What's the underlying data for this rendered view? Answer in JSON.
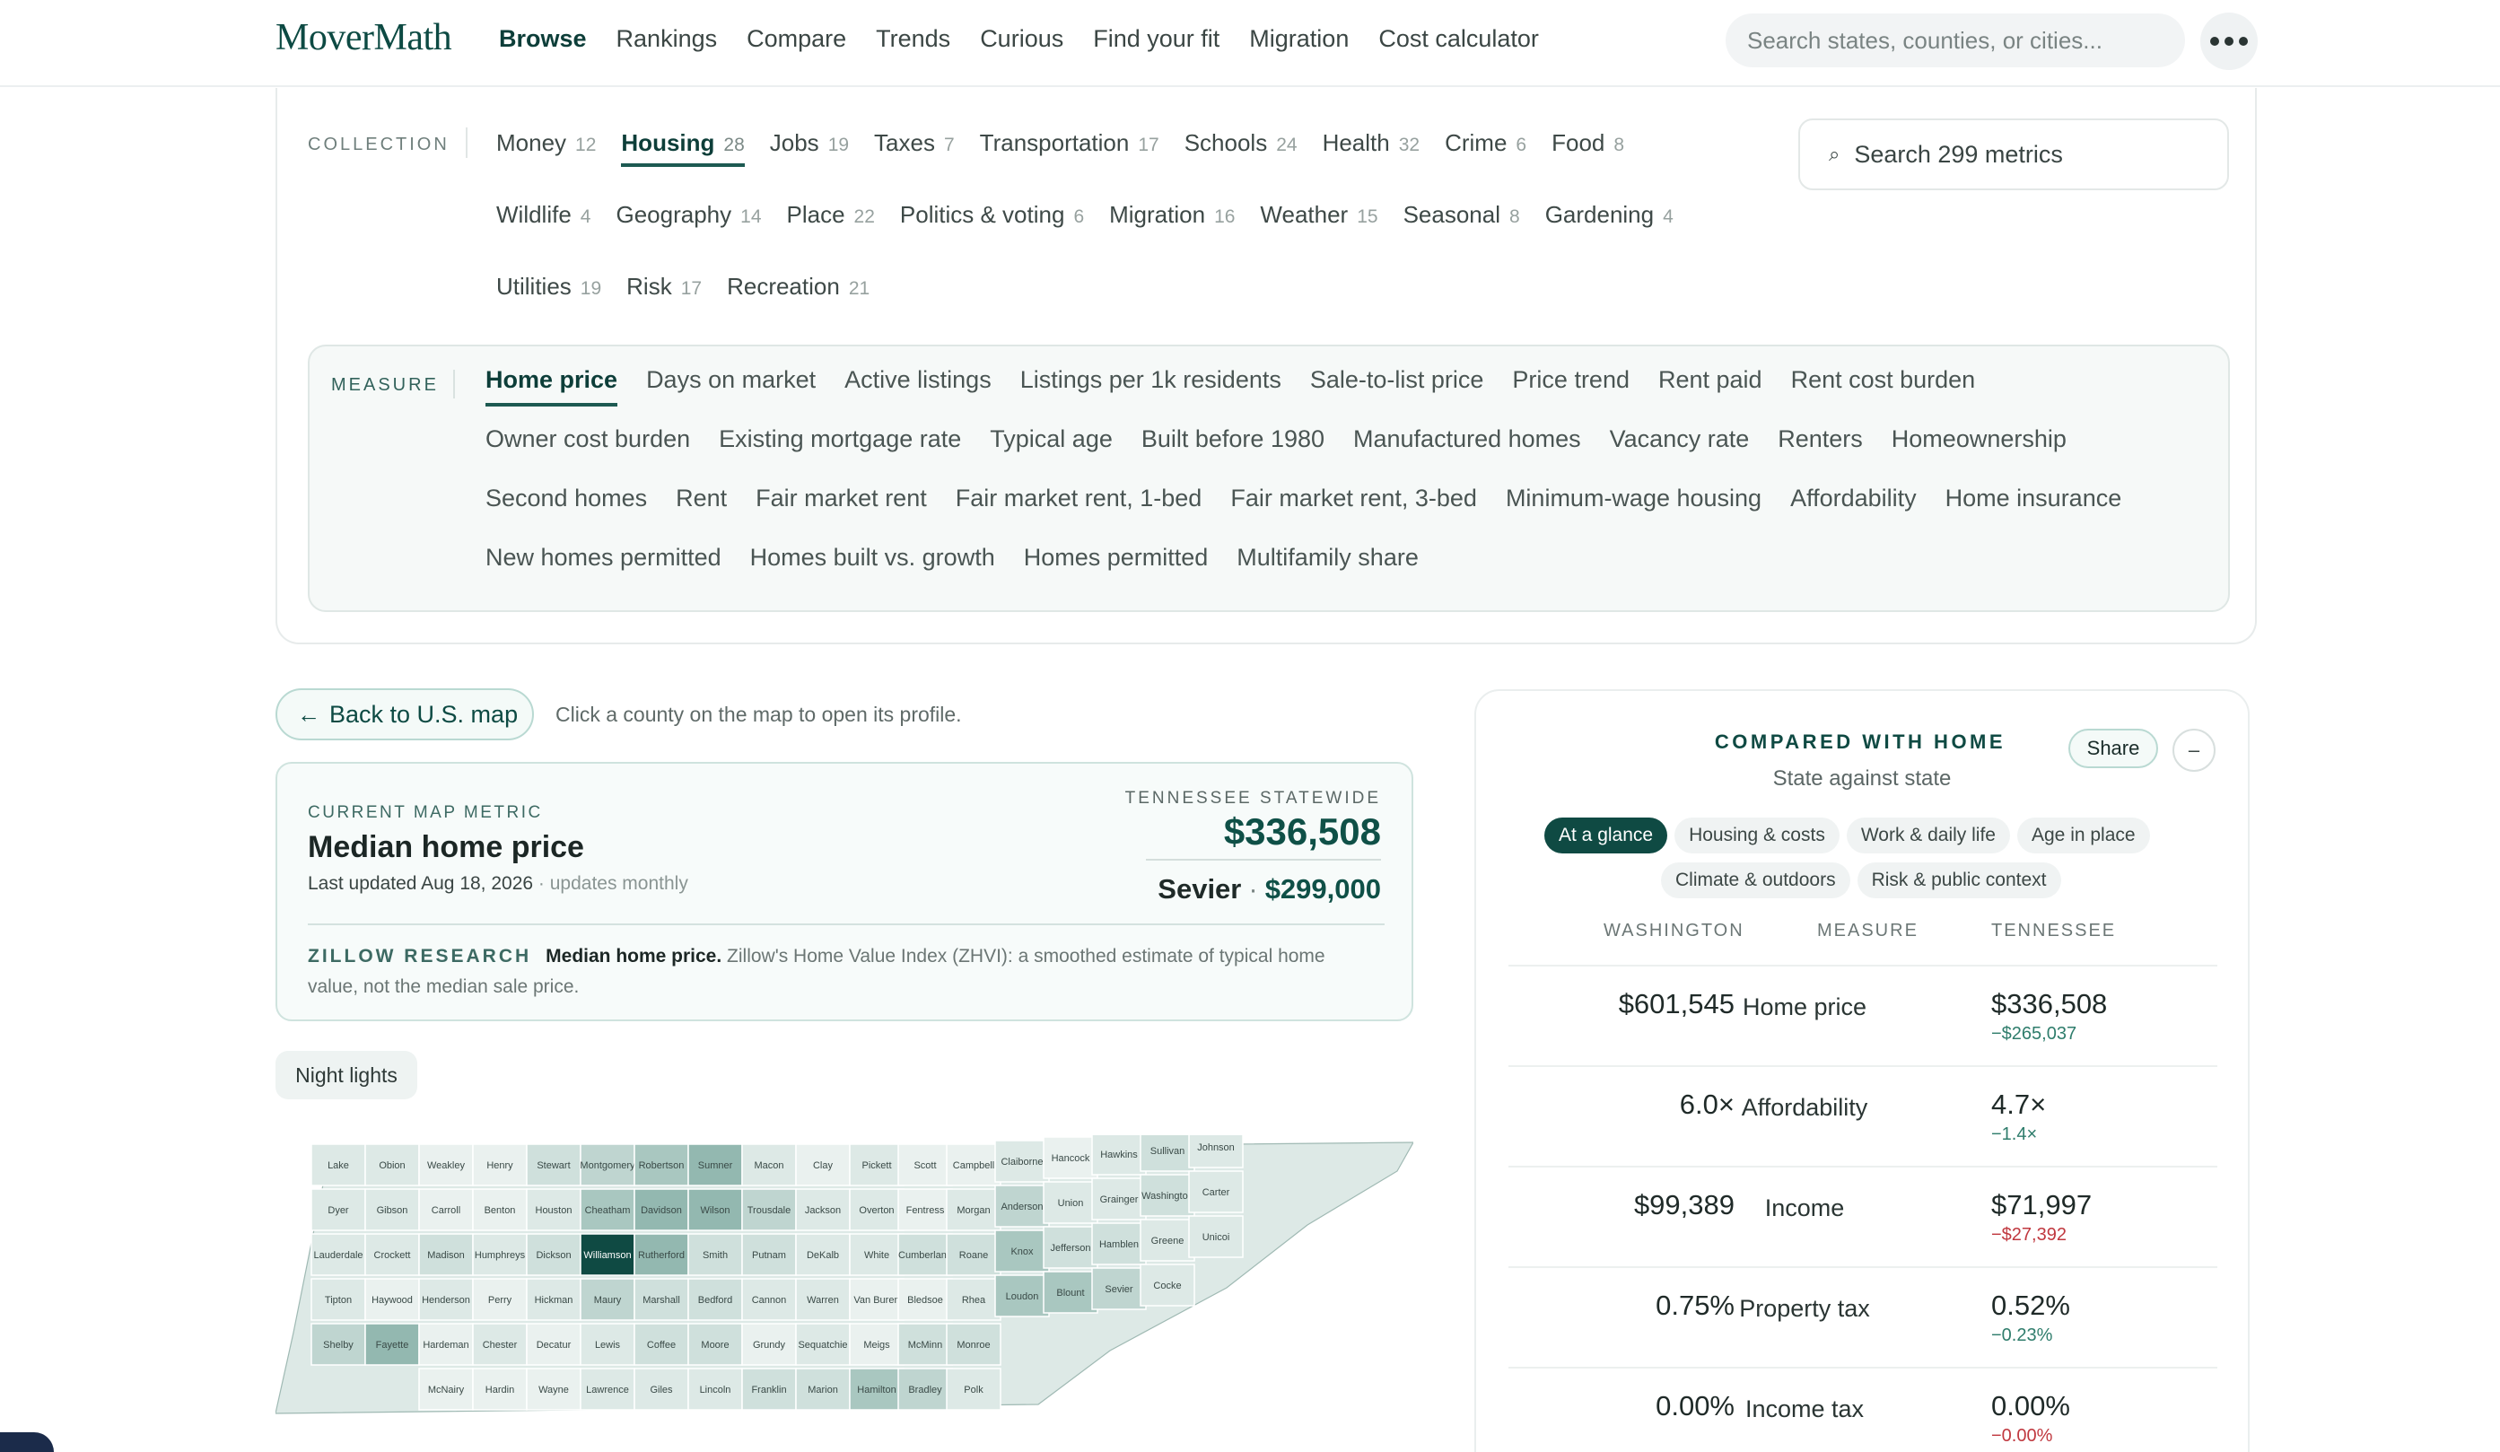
{
  "brand": {
    "logo": "MoverMath"
  },
  "nav": {
    "items": [
      "Browse",
      "Rankings",
      "Compare",
      "Trends",
      "Curious",
      "Find your fit",
      "Migration",
      "Cost calculator"
    ],
    "active": "Browse",
    "search_placeholder": "Search states, counties, or cities..."
  },
  "collection": {
    "label": "COLLECTION",
    "rows": [
      [
        {
          "label": "Money",
          "count": "12"
        },
        {
          "label": "Housing",
          "count": "28",
          "active": true
        },
        {
          "label": "Jobs",
          "count": "19"
        },
        {
          "label": "Taxes",
          "count": "7"
        },
        {
          "label": "Transportation",
          "count": "17"
        },
        {
          "label": "Schools",
          "count": "24"
        },
        {
          "label": "Health",
          "count": "32"
        },
        {
          "label": "Crime",
          "count": "6"
        },
        {
          "label": "Food",
          "count": "8"
        }
      ],
      [
        {
          "label": "Wildlife",
          "count": "4"
        },
        {
          "label": "Geography",
          "count": "14"
        },
        {
          "label": "Place",
          "count": "22"
        },
        {
          "label": "Politics & voting",
          "count": "6"
        },
        {
          "label": "Migration",
          "count": "16"
        },
        {
          "label": "Weather",
          "count": "15"
        },
        {
          "label": "Seasonal",
          "count": "8"
        },
        {
          "label": "Gardening",
          "count": "4"
        }
      ],
      [
        {
          "label": "Utilities",
          "count": "19"
        },
        {
          "label": "Risk",
          "count": "17"
        },
        {
          "label": "Recreation",
          "count": "21"
        }
      ]
    ],
    "search_placeholder": "Search 299 metrics",
    "search_icon": "⌕"
  },
  "measure": {
    "label": "MEASURE",
    "rows": [
      [
        "Home price",
        "Days on market",
        "Active listings",
        "Listings per 1k residents",
        "Sale-to-list price",
        "Price trend",
        "Rent paid",
        "Rent cost burden"
      ],
      [
        "Owner cost burden",
        "Existing mortgage rate",
        "Typical age",
        "Built before 1980",
        "Manufactured homes",
        "Vacancy rate",
        "Renters",
        "Homeownership"
      ],
      [
        "Second homes",
        "Rent",
        "Fair market rent",
        "Fair market rent, 1-bed",
        "Fair market rent, 3-bed",
        "Minimum-wage housing",
        "Affordability",
        "Home insurance"
      ],
      [
        "New homes permitted",
        "Homes built vs. growth",
        "Homes permitted",
        "Multifamily share"
      ]
    ],
    "active": "Home price"
  },
  "back": {
    "arrow": "←",
    "label": "Back to U.S. map",
    "hint": "Click a county on the map to open its profile."
  },
  "metric_card": {
    "eyebrow": "CURRENT MAP METRIC",
    "title": "Median home price",
    "updated": "Last updated Aug 18, 2026",
    "updated_sub": " · updates monthly",
    "state_label": "TENNESSEE STATEWIDE",
    "state_value": "$336,508",
    "county_name": "Sevier",
    "county_dot": "·",
    "county_value": "$299,000",
    "source_tag": "ZILLOW RESEARCH",
    "source_bold": "Median home price.",
    "source_text": "Zillow's Home Value Index (ZHVI): a smoothed estimate of typical home value, not the median sale price."
  },
  "night_lights": "Night lights",
  "map": {
    "counties": [
      "Lake",
      "Obion",
      "Weakley",
      "Henry",
      "Stewart",
      "Montgomery",
      "Robertson",
      "Sumner",
      "Macon",
      "Clay",
      "Pickett",
      "Scott",
      "Campbell",
      "Claiborne",
      "Hancock",
      "Hawkins",
      "Sullivan",
      "Johnson",
      "Dyer",
      "Gibson",
      "Carroll",
      "Benton",
      "Houston",
      "Humphreys",
      "Dickson",
      "Cheatham",
      "Davidson",
      "Wilson",
      "Trousdale",
      "Smith",
      "Jackson",
      "Overton",
      "Fentress",
      "Morgan",
      "Anderson",
      "Union",
      "Grainger",
      "Hamblen",
      "Washington",
      "Carter",
      "Unicoi",
      "Greene",
      "Jefferson",
      "Cocke",
      "Knox",
      "Sevier",
      "Blount",
      "Loudon",
      "Roane",
      "Cumberland",
      "Putnam",
      "White",
      "DeKalb",
      "Cannon",
      "Warren",
      "Van Buren",
      "Bledsoe",
      "Rhea",
      "Meigs",
      "McMinn",
      "Monroe",
      "Lauderdale",
      "Crockett",
      "Haywood",
      "Madison",
      "Henderson",
      "Decatur",
      "Perry",
      "Hickman",
      "Lewis",
      "Maury",
      "Williamson",
      "Rutherford",
      "Bedford",
      "Coffee",
      "Grundy",
      "Sequatchie",
      "Marshall",
      "Tipton",
      "Chester",
      "Shelby",
      "Fayette",
      "Hardeman",
      "McNairy",
      "Hardin",
      "Wayne",
      "Lawrence",
      "Giles",
      "Lincoln",
      "Franklin",
      "Marion",
      "Hamilton",
      "Bradley",
      "Polk",
      "Moore"
    ],
    "highlight": "Williamson"
  },
  "compare": {
    "title": "COMPARED WITH HOME",
    "subtitle": "State against state",
    "share": "Share",
    "minimize": "–",
    "chips_row1": [
      "At a glance",
      "Housing & costs",
      "Work & daily life",
      "Age in place"
    ],
    "chips_row2": [
      "Climate & outdoors",
      "Risk & public context"
    ],
    "active_chip": "At a glance",
    "head_left": "WASHINGTON",
    "head_mid": "MEASURE",
    "head_right": "TENNESSEE",
    "rows": [
      {
        "left": "$601,545",
        "measure": "Home price",
        "right": "$336,508",
        "diff": "−$265,037",
        "tone": "pos"
      },
      {
        "left": "6.0×",
        "measure": "Affordability",
        "right": "4.7×",
        "diff": "−1.4×",
        "tone": "pos"
      },
      {
        "left": "$99,389",
        "measure": "Income",
        "right": "$71,997",
        "diff": "−$27,392",
        "tone": "neg"
      },
      {
        "left": "0.75%",
        "measure": "Property tax",
        "right": "0.52%",
        "diff": "−0.23%",
        "tone": "pos"
      },
      {
        "left": "0.00%",
        "measure": "Income tax",
        "right": "0.00%",
        "diff": "−0.00%",
        "tone": "neg"
      }
    ]
  }
}
